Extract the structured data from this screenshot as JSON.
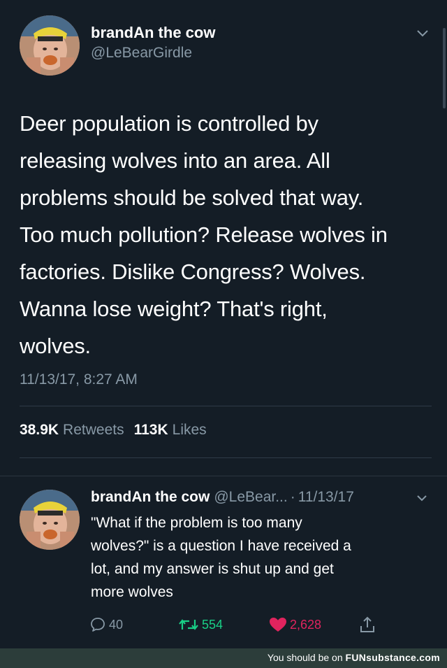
{
  "main_tweet": {
    "display_name": "brandAn the cow",
    "handle": "@LeBearGirdle",
    "avatar_icon": "profile-photo-avatar",
    "text_lines": [
      "Deer population is controlled by",
      "releasing wolves into an area. All",
      "problems should be solved that way.",
      "Too much pollution? Release wolves in",
      "factories. Dislike Congress? Wolves.",
      "Wanna lose weight? That's right,",
      "wolves."
    ],
    "timestamp": "11/13/17, 8:27 AM",
    "retweets_count": "38.9K",
    "retweets_label": "Retweets",
    "likes_count": "113K",
    "likes_label": "Likes"
  },
  "reply_tweet": {
    "display_name": "brandAn the cow",
    "handle": "@LeBear...",
    "separator": "·",
    "date": "11/13/17",
    "avatar_icon": "profile-photo-avatar",
    "text_lines": [
      "\"What if the problem is too many",
      "wolves?\" is a question I have received a",
      "lot, and my answer is shut up and get",
      "more wolves"
    ],
    "reply_count": "40",
    "retweet_count": "554",
    "like_count": "2,628"
  },
  "footer": {
    "prefix": "You should be on",
    "brand": "FUNsubstance.com"
  },
  "colors": {
    "background": "#141d26",
    "secondary_text": "#8899a6",
    "retweet_green": "#19cf86",
    "like_red": "#e0245e",
    "footer_bg": "#2c3d3a"
  }
}
